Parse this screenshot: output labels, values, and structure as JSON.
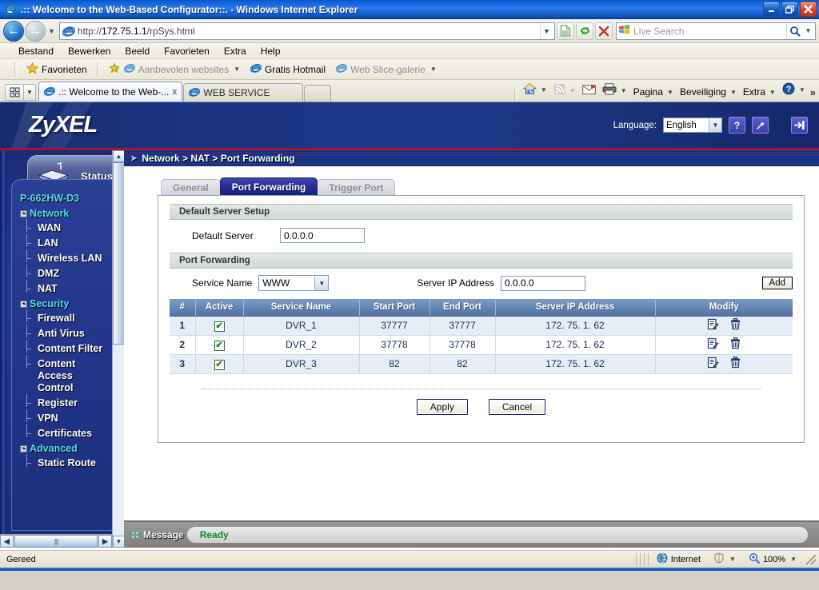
{
  "window": {
    "title": ".:: Welcome to the Web-Based Configurator::. - Windows Internet Explorer",
    "minimize_label": "Minimize",
    "restore_label": "Restore",
    "close_label": "Close"
  },
  "address_bar": {
    "url_protocol": "http://",
    "url_host": "172.75.1.1",
    "url_path": "/rpSys.html",
    "url_full": "http://172.75.1.1/rpSys.html",
    "search_placeholder": "Live Search",
    "back_label": "Back",
    "forward_label": "Forward"
  },
  "menu": {
    "items": [
      {
        "label": "Bestand",
        "accel": "e"
      },
      {
        "label": "Bewerken",
        "accel": "w"
      },
      {
        "label": "Beeld",
        "accel": "B"
      },
      {
        "label": "Favorieten",
        "accel": "F"
      },
      {
        "label": "Extra",
        "accel": "x"
      },
      {
        "label": "Help",
        "accel": "H"
      }
    ]
  },
  "favorites_bar": {
    "favorites_label": "Favorieten",
    "items": [
      {
        "label": "Aanbevolen websites",
        "has_caret": true
      },
      {
        "label": "Gratis Hotmail",
        "has_caret": false
      },
      {
        "label": "Web Slice-galerie",
        "has_caret": true
      }
    ]
  },
  "tabs": {
    "quick_tabs_label": "Quick Tabs",
    "items": [
      {
        "label": ".:: Welcome to the Web-...",
        "active": true,
        "close": "x"
      },
      {
        "label": "WEB SERVICE",
        "active": false
      }
    ]
  },
  "command_bar": {
    "items": [
      {
        "label": "Pagina",
        "icon": "page-icon",
        "caret": true
      },
      {
        "label": "Beveiliging",
        "icon": "security-icon",
        "caret": true
      },
      {
        "label": "Extra",
        "icon": "tools-icon",
        "caret": true
      }
    ],
    "overflow": "»"
  },
  "router": {
    "brand": "ZyXEL",
    "language_label": "Language:",
    "language_value": "English",
    "help_icon_label": "?",
    "wizard_icon_label": "wizard",
    "logout_icon_label": "logout",
    "status_tab_label": "Status",
    "device_name": "P-662HW-D3",
    "breadcrumb": "Network > NAT > Port Forwarding",
    "nav": [
      {
        "type": "group",
        "label": "Network",
        "expander": "-"
      },
      {
        "type": "item",
        "label": "WAN"
      },
      {
        "type": "item",
        "label": "LAN"
      },
      {
        "type": "item",
        "label": "Wireless LAN"
      },
      {
        "type": "item",
        "label": "DMZ"
      },
      {
        "type": "item",
        "label": "NAT"
      },
      {
        "type": "group",
        "label": "Security",
        "expander": "-"
      },
      {
        "type": "item",
        "label": "Firewall"
      },
      {
        "type": "item",
        "label": "Anti Virus"
      },
      {
        "type": "item",
        "label": "Content Filter"
      },
      {
        "type": "item",
        "label": "Content Access Control"
      },
      {
        "type": "item",
        "label": "Register"
      },
      {
        "type": "item",
        "label": "VPN"
      },
      {
        "type": "item",
        "label": "Certificates"
      },
      {
        "type": "group",
        "label": "Advanced",
        "expander": "-"
      },
      {
        "type": "item",
        "label": "Static Route"
      }
    ]
  },
  "page_tabs": [
    {
      "label": "General",
      "active": false
    },
    {
      "label": "Port Forwarding",
      "active": true
    },
    {
      "label": "Trigger Port",
      "active": false
    }
  ],
  "default_server_section": {
    "title": "Default Server Setup",
    "field_label": "Default Server",
    "field_value": "0.0.0.0"
  },
  "port_forwarding_section": {
    "title": "Port Forwarding",
    "service_name_label": "Service Name",
    "service_name_value": "WWW",
    "server_ip_label": "Server IP Address",
    "server_ip_value": "0.0.0.0",
    "add_button": "Add",
    "columns": [
      "#",
      "Active",
      "Service Name",
      "Start Port",
      "End Port",
      "Server IP Address",
      "Modify"
    ],
    "rows": [
      {
        "index": "1",
        "active": true,
        "service_name": "DVR_1",
        "start_port": "37777",
        "end_port": "37777",
        "server_ip": "172. 75. 1. 62"
      },
      {
        "index": "2",
        "active": true,
        "service_name": "DVR_2",
        "start_port": "37778",
        "end_port": "37778",
        "server_ip": "172. 75. 1. 62"
      },
      {
        "index": "3",
        "active": true,
        "service_name": "DVR_3",
        "start_port": "82",
        "end_port": "82",
        "server_ip": "172. 75. 1. 62"
      }
    ],
    "checkbox_glyph": "✔",
    "apply_button": "Apply",
    "cancel_button": "Cancel"
  },
  "message_bar": {
    "label": "Message",
    "status": "Ready"
  },
  "status_bar": {
    "left_text": "Gereed",
    "zone": "Internet",
    "zoom": "100%"
  },
  "colors": {
    "titlebar_blue": "#0b5fd6",
    "zyxel_navy": "#1c3684",
    "accent_red": "#a7142a",
    "tab_active": "#262b90",
    "table_header": "#6888b8",
    "row_alt": "#e6edf6",
    "link_cyan": "#4fe0ef",
    "ready_green": "#0a8a20"
  }
}
